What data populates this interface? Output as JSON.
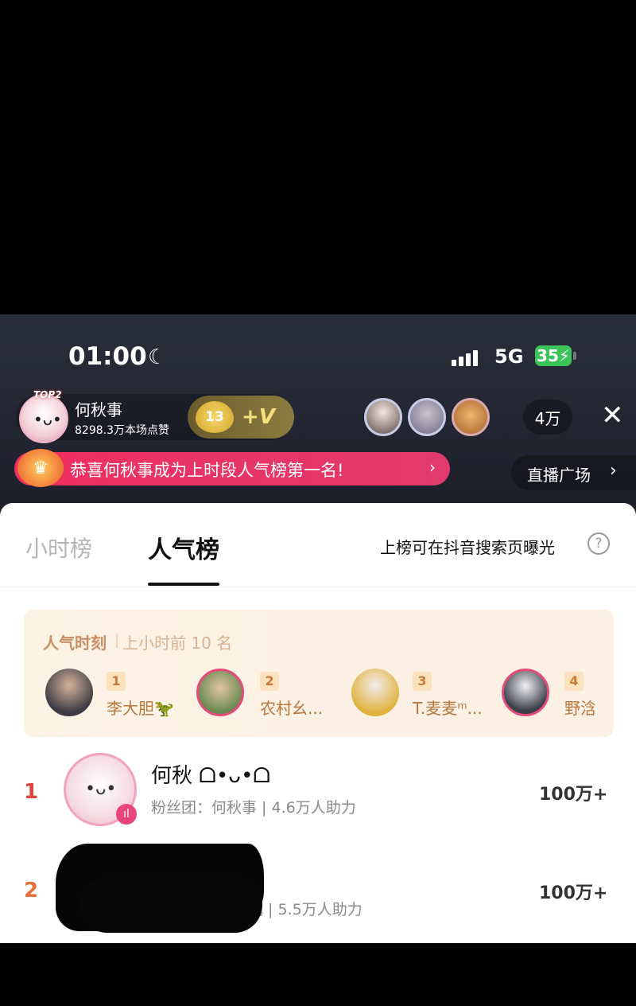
{
  "status_bar": {
    "time": "01:00",
    "network": "5G",
    "battery": "35"
  },
  "live": {
    "host": {
      "badge": "TOP2",
      "name": "何秋事",
      "likes": "8298.3万本场点赞"
    },
    "fan_badge": {
      "level": "13",
      "plus": "+V"
    },
    "viewer_count": "4万",
    "congrats": "恭喜何秋事成为上时段人气榜第一名!",
    "plaza": "直播广场"
  },
  "panel": {
    "tabs": [
      {
        "label": "小时榜"
      },
      {
        "label": "人气榜"
      }
    ],
    "exposure_hint": "上榜可在抖音搜索页曝光",
    "help": "?",
    "moment": {
      "title": "人气时刻",
      "subtitle": "上小时前 10 名",
      "items": [
        {
          "rank": "1",
          "name": "李大胆",
          "emoji": "🦖"
        },
        {
          "rank": "2",
          "name": "农村幺..."
        },
        {
          "rank": "3",
          "name": "T.麦麦ᵐ..."
        },
        {
          "rank": "4",
          "name": "野浛"
        }
      ]
    },
    "ranking": [
      {
        "rank": "1",
        "name": "何秋 ᗝ•ᴗ•ᗝ",
        "fans": "粉丝团：何秋事 | 4.6万人助力",
        "score": "100万+"
      },
      {
        "rank": "2",
        "fans": "儿 | 5.5万人助力",
        "score": "100万+"
      }
    ]
  },
  "colors": {
    "accent_pink": "#e8447e",
    "rank1": "#e0443e",
    "rank2": "#e8703a",
    "moment_text": "#b9773c"
  }
}
